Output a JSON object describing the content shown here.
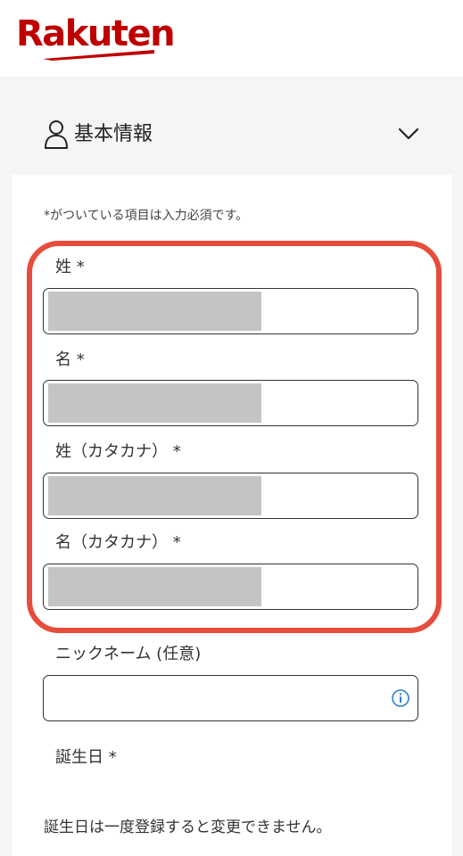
{
  "header": {
    "logo_text": "Rakuten"
  },
  "section": {
    "title": "基本情報"
  },
  "form": {
    "required_note": "*がついている項目は入力必須です。",
    "fields": [
      {
        "label": "姓 *",
        "value": ""
      },
      {
        "label": "名 *",
        "value": ""
      },
      {
        "label": "姓（カタカナ） *",
        "value": ""
      },
      {
        "label": "名（カタカナ） *",
        "value": ""
      },
      {
        "label": "ニックネーム (任意)",
        "value": ""
      },
      {
        "label": "誕生日 *"
      }
    ],
    "birthday_note": "誕生日は一度登録すると変更できません。"
  },
  "colors": {
    "brand": "#bf0000",
    "highlight": "#e74c3c",
    "info": "#2a7fd4"
  }
}
